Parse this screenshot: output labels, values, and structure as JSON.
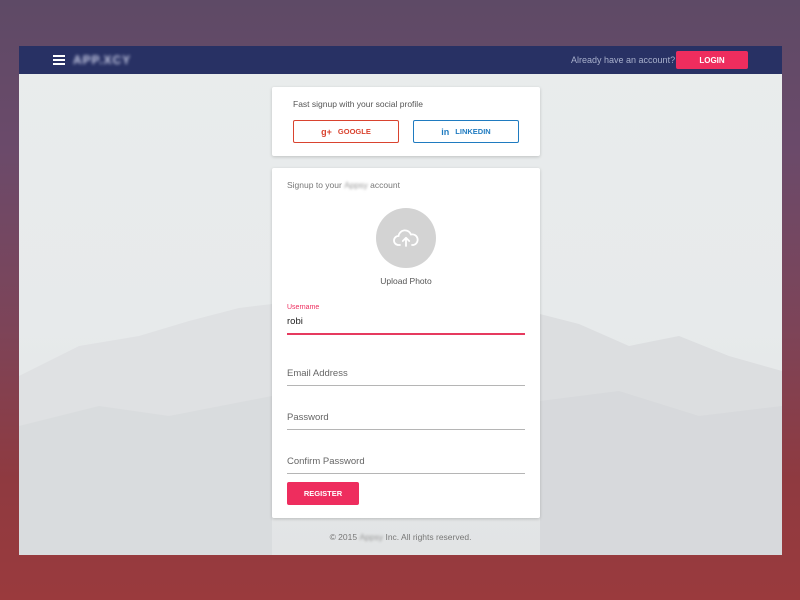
{
  "header": {
    "logo_text": "APP.XCY",
    "already_text": "Already have an account?",
    "login_label": "LOGIN"
  },
  "social": {
    "title": "Fast signup with your social profile",
    "google_icon": "g+",
    "google_label": "GOOGLE",
    "linkedin_icon": "in",
    "linkedin_label": "LINKEDIN"
  },
  "signup": {
    "title_prefix": "Signup to your ",
    "title_brand": "Appsy",
    "title_suffix": " account",
    "upload_label": "Upload Photo",
    "fields": {
      "username": {
        "label": "Username",
        "value": "robi",
        "placeholder": ""
      },
      "email": {
        "placeholder": "Email Address",
        "value": ""
      },
      "password": {
        "placeholder": "Password",
        "value": ""
      },
      "confirm": {
        "placeholder": "Confirm Password",
        "value": ""
      }
    },
    "register_label": "REGISTER"
  },
  "footer": {
    "prefix": "© 2015 ",
    "brand": "Appsy",
    "suffix": " Inc. All rights reserved."
  },
  "colors": {
    "navbar": "#283164",
    "accent": "#ee2d5e",
    "google": "#d9432f",
    "linkedin": "#1f7bc0"
  },
  "icons": {
    "menu": "hamburger-menu-icon",
    "upload": "cloud-upload-icon",
    "google": "google-plus-icon",
    "linkedin": "linkedin-icon"
  }
}
